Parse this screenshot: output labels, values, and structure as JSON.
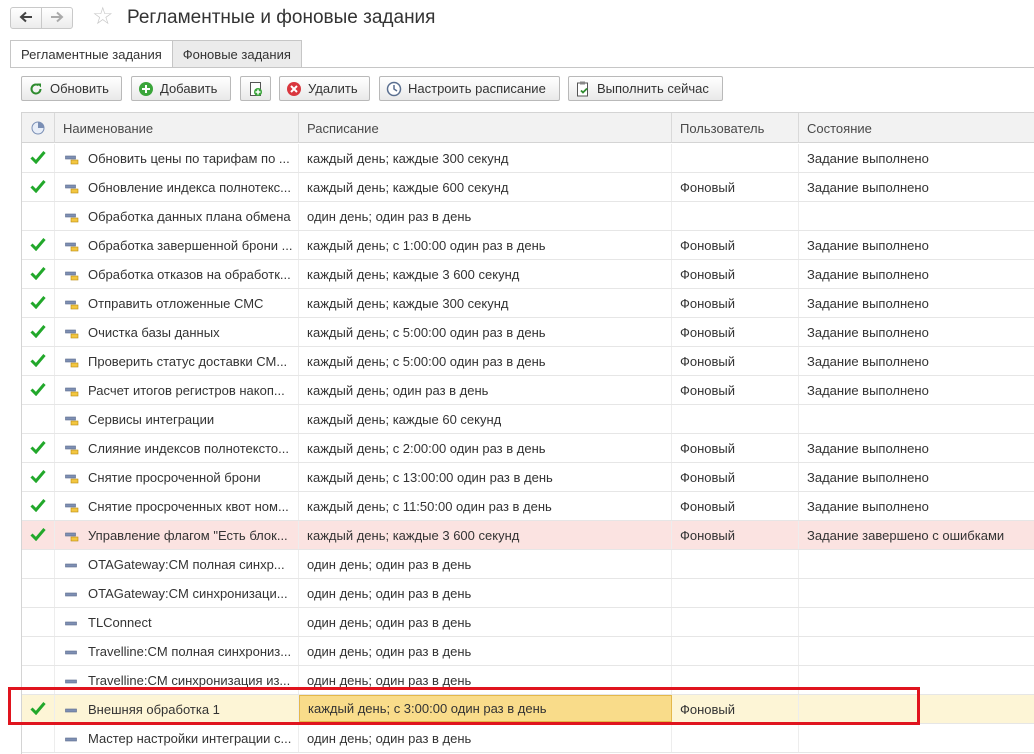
{
  "window": {
    "title": "Регламентные и фоновые задания",
    "nav": {
      "back_icon": "arrow-left-icon",
      "forward_icon": "arrow-right-icon",
      "favorite_icon": "star-icon"
    }
  },
  "tabs": [
    {
      "label": "Регламентные задания",
      "active": true
    },
    {
      "label": "Фоновые задания",
      "active": false
    }
  ],
  "toolbar": {
    "refresh": "Обновить",
    "add": "Добавить",
    "copy_icon": "copy-icon",
    "delete": "Удалить",
    "schedule": "Настроить расписание",
    "run_now": "Выполнить сейчас"
  },
  "table": {
    "columns": {
      "status_icon": "status-column-icon",
      "name": "Наименование",
      "schedule": "Расписание",
      "user": "Пользователь",
      "state": "Состояние"
    },
    "rows": [
      {
        "check": true,
        "name": "Обновить цены по тарифам по ...",
        "schedule": "каждый день; каждые 300 секунд",
        "user": "",
        "state": "Задание выполнено",
        "kind": "task"
      },
      {
        "check": true,
        "name": "Обновление индекса полнотекс...",
        "schedule": "каждый день; каждые 600 секунд",
        "user": "Фоновый",
        "state": "Задание выполнено",
        "kind": "task"
      },
      {
        "check": false,
        "name": "Обработка данных плана обмена",
        "schedule": "один день; один раз в день",
        "user": "",
        "state": "",
        "kind": "task"
      },
      {
        "check": true,
        "name": "Обработка завершенной брони ...",
        "schedule": "каждый день; с 1:00:00 один раз в день",
        "user": "Фоновый",
        "state": "Задание выполнено",
        "kind": "task"
      },
      {
        "check": true,
        "name": "Обработка отказов на обработк...",
        "schedule": "каждый день; каждые 3 600 секунд",
        "user": "Фоновый",
        "state": "Задание выполнено",
        "kind": "task"
      },
      {
        "check": true,
        "name": "Отправить отложенные СМС",
        "schedule": "каждый день; каждые 300 секунд",
        "user": "Фоновый",
        "state": "Задание выполнено",
        "kind": "task"
      },
      {
        "check": true,
        "name": "Очистка базы данных",
        "schedule": "каждый день; с 5:00:00 один раз в день",
        "user": "Фоновый",
        "state": "Задание выполнено",
        "kind": "task"
      },
      {
        "check": true,
        "name": "Проверить статус доставки СМ...",
        "schedule": "каждый день; с 5:00:00 один раз в день",
        "user": "Фоновый",
        "state": "Задание выполнено",
        "kind": "task"
      },
      {
        "check": true,
        "name": "Расчет итогов регистров накоп...",
        "schedule": "каждый день; один раз в день",
        "user": "Фоновый",
        "state": "Задание выполнено",
        "kind": "task"
      },
      {
        "check": false,
        "name": "Сервисы интеграции",
        "schedule": "каждый день; каждые 60 секунд",
        "user": "",
        "state": "",
        "kind": "task"
      },
      {
        "check": true,
        "name": "Слияние индексов полнотексто...",
        "schedule": "каждый день; с 2:00:00 один раз в день",
        "user": "Фоновый",
        "state": "Задание выполнено",
        "kind": "task"
      },
      {
        "check": true,
        "name": "Снятие просроченной брони",
        "schedule": "каждый день; с 13:00:00 один раз в день",
        "user": "Фоновый",
        "state": "Задание выполнено",
        "kind": "task"
      },
      {
        "check": true,
        "name": "Снятие просроченных квот ном...",
        "schedule": "каждый день; с 11:50:00 один раз в день",
        "user": "Фоновый",
        "state": "Задание выполнено",
        "kind": "task"
      },
      {
        "check": true,
        "name": "Управление флагом \"Есть блок...",
        "schedule": "каждый день; каждые 3 600 секунд",
        "user": "Фоновый",
        "state": "Задание завершено с ошибками",
        "kind": "task",
        "error": true
      },
      {
        "check": false,
        "name": "OTAGateway:CM полная синхр...",
        "schedule": "один день; один раз в день",
        "user": "",
        "state": "",
        "kind": "ext"
      },
      {
        "check": false,
        "name": "OTAGateway:CM синхронизаци...",
        "schedule": "один день; один раз в день",
        "user": "",
        "state": "",
        "kind": "ext"
      },
      {
        "check": false,
        "name": "TLConnect",
        "schedule": "один день; один раз в день",
        "user": "",
        "state": "",
        "kind": "ext"
      },
      {
        "check": false,
        "name": "Travelline:CM полная синхрониз...",
        "schedule": "один день; один раз в день",
        "user": "",
        "state": "",
        "kind": "ext"
      },
      {
        "check": false,
        "name": "Travelline:CM синхронизация из...",
        "schedule": "один день; один раз в день",
        "user": "",
        "state": "",
        "kind": "ext"
      },
      {
        "check": true,
        "name": "Внешняя обработка 1",
        "schedule": "каждый день; с 3:00:00 один раз в день",
        "user": "Фоновый",
        "state": "",
        "kind": "ext",
        "selected": true
      },
      {
        "check": false,
        "name": "Мастер настройки интеграции с...",
        "schedule": "один день; один раз в день",
        "user": "",
        "state": "",
        "kind": "ext"
      }
    ]
  },
  "colors": {
    "check": "#22a82b",
    "error_row": "#fbe3e1",
    "selected_row": "#fdf5d6",
    "highlight_box": "#e0141e"
  }
}
